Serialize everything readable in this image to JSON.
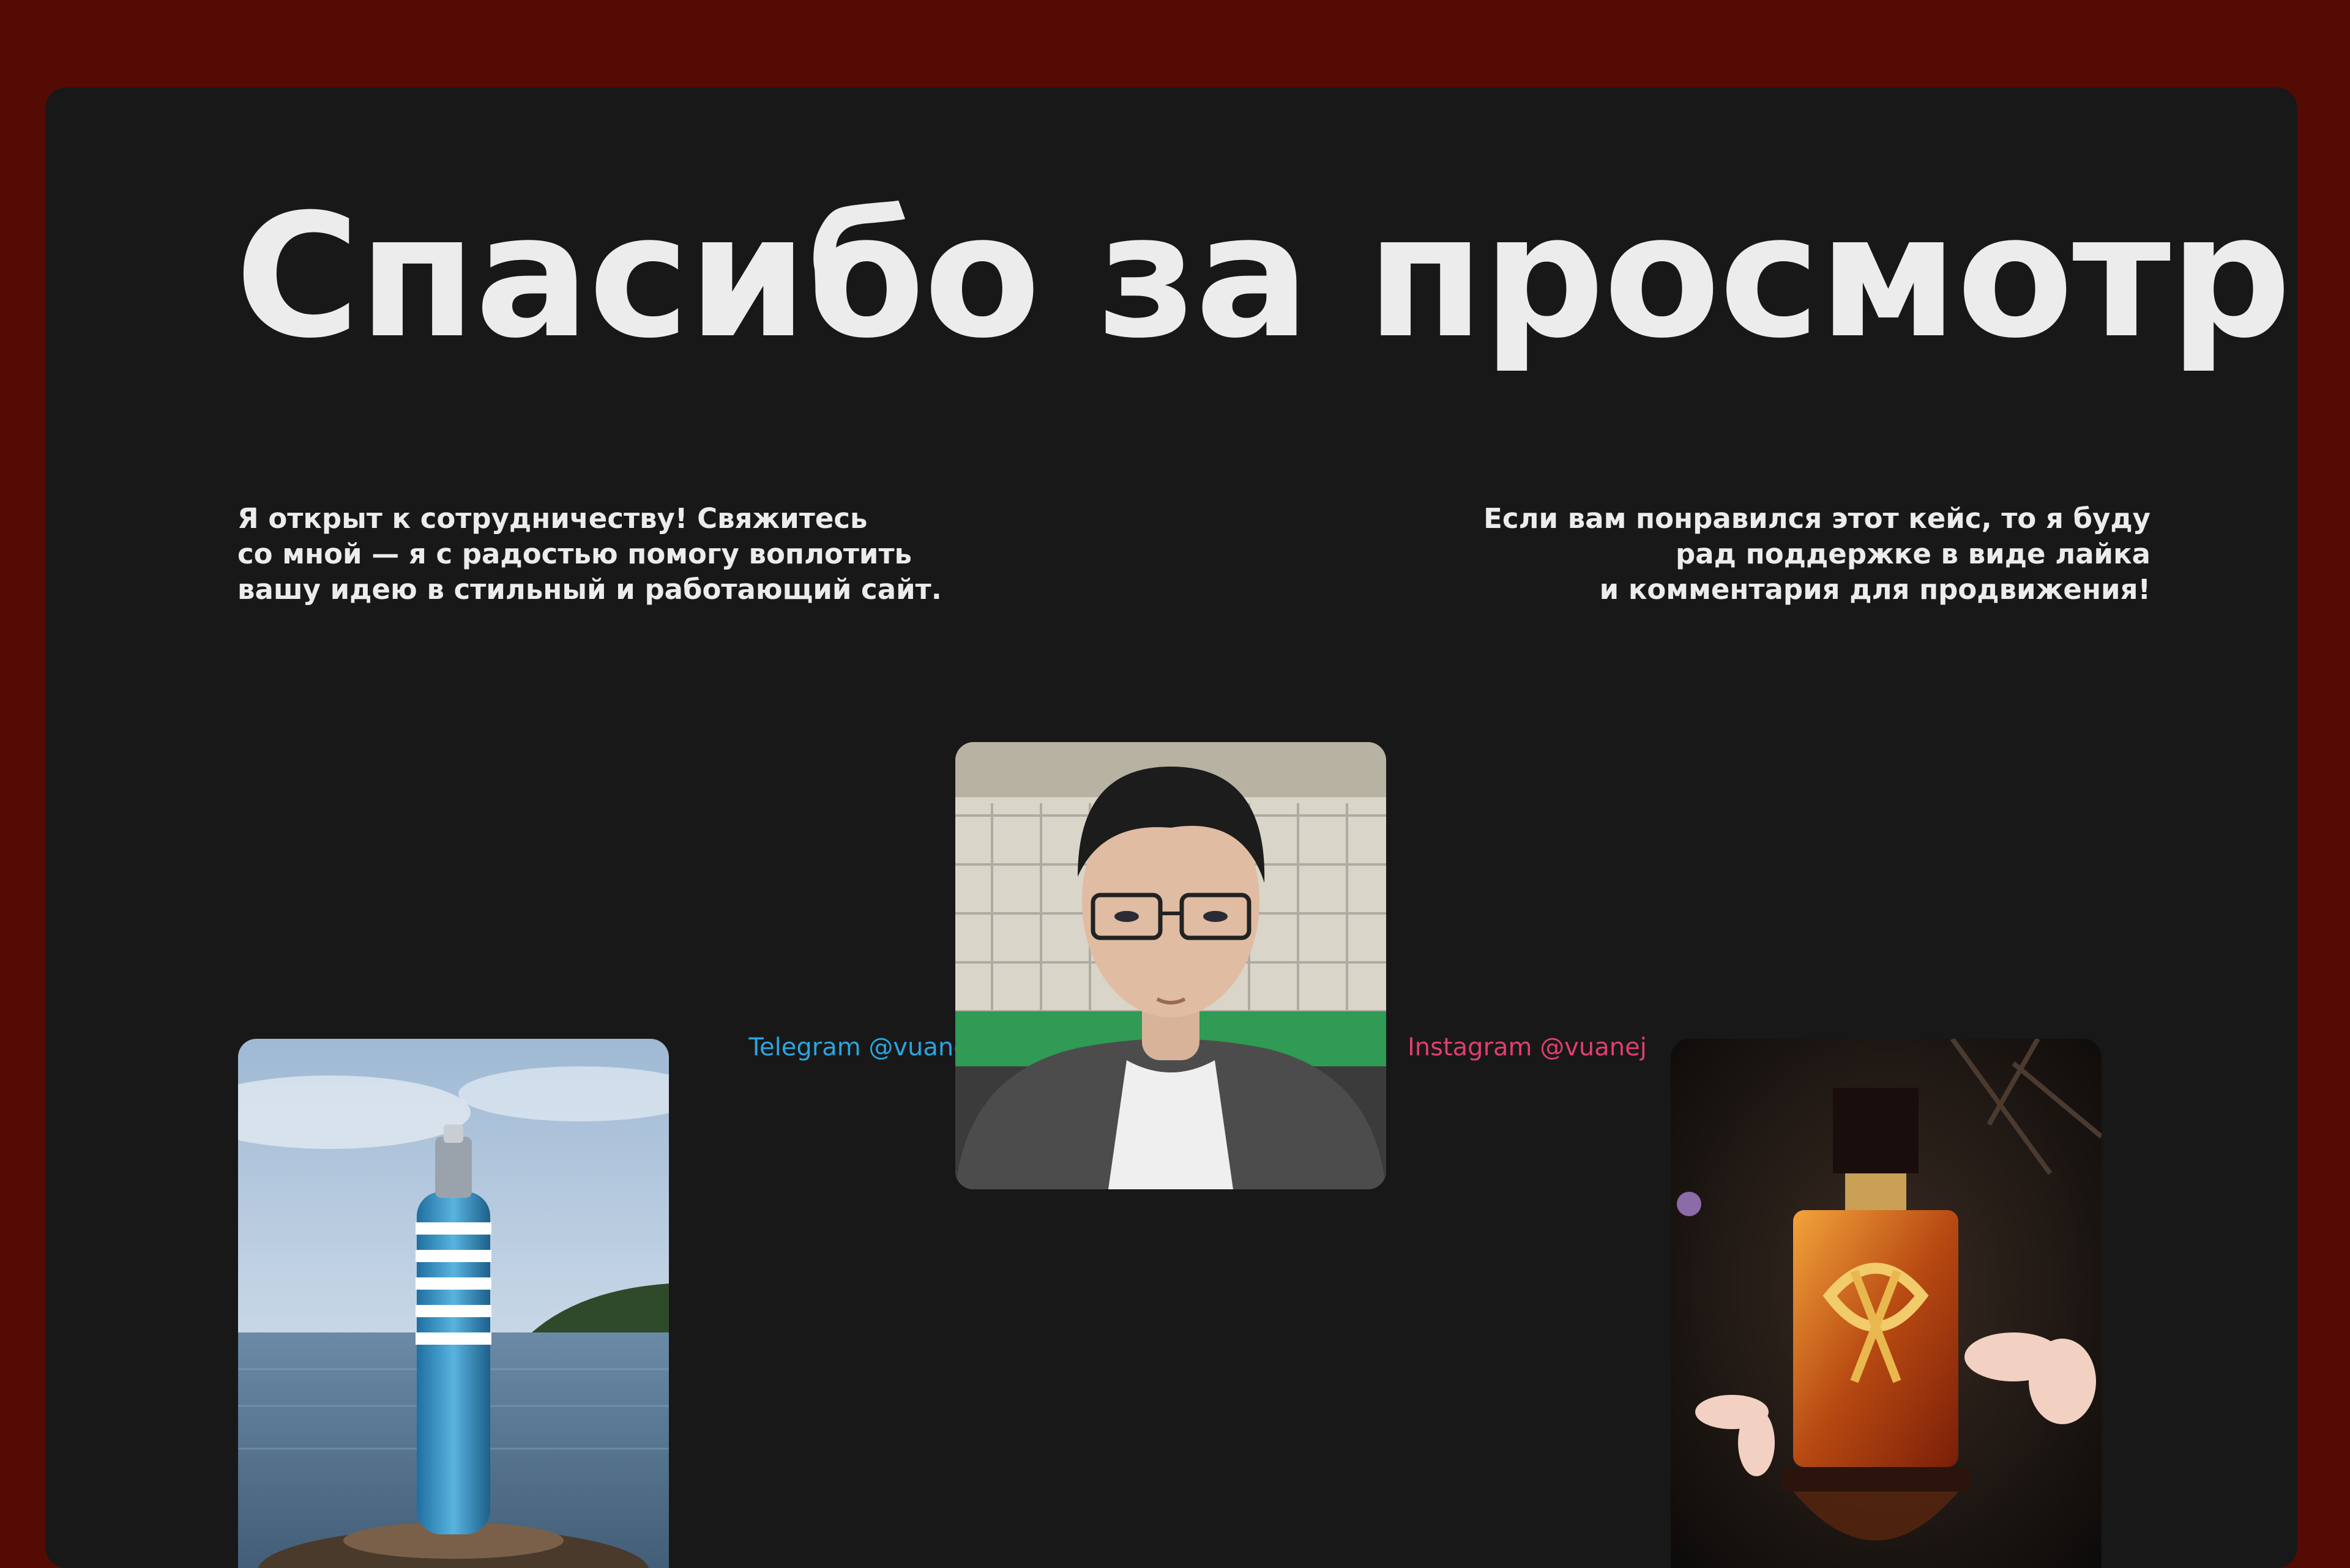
{
  "page": {
    "background_color": "#540b04",
    "panel_color": "#181818",
    "text_color": "#ececec"
  },
  "hero": {
    "title": "Спасибо за просмотр!"
  },
  "intro": {
    "left": [
      "Я открыт к сотрудничеству! Свяжитесь",
      "со мной — я с радостью помогу воплотить",
      "вашу идею в стильный и работающий сайт."
    ],
    "right": [
      "Если вам понравился этот кейс, то я буду",
      "рад поддержке в виде лайка",
      "и комментария для продвижения!"
    ]
  },
  "contacts": {
    "telegram": {
      "label": "Telegram @vuanej",
      "color": "#2aa5e0"
    },
    "instagram": {
      "label": "Instagram @vuanej",
      "color": "#e03f6f"
    }
  },
  "photos": {
    "left": {
      "icon": "perfume-bottle-sea-photo"
    },
    "center": {
      "icon": "portrait-photo"
    },
    "right": {
      "icon": "perfume-bottle-flowers-photo"
    }
  }
}
